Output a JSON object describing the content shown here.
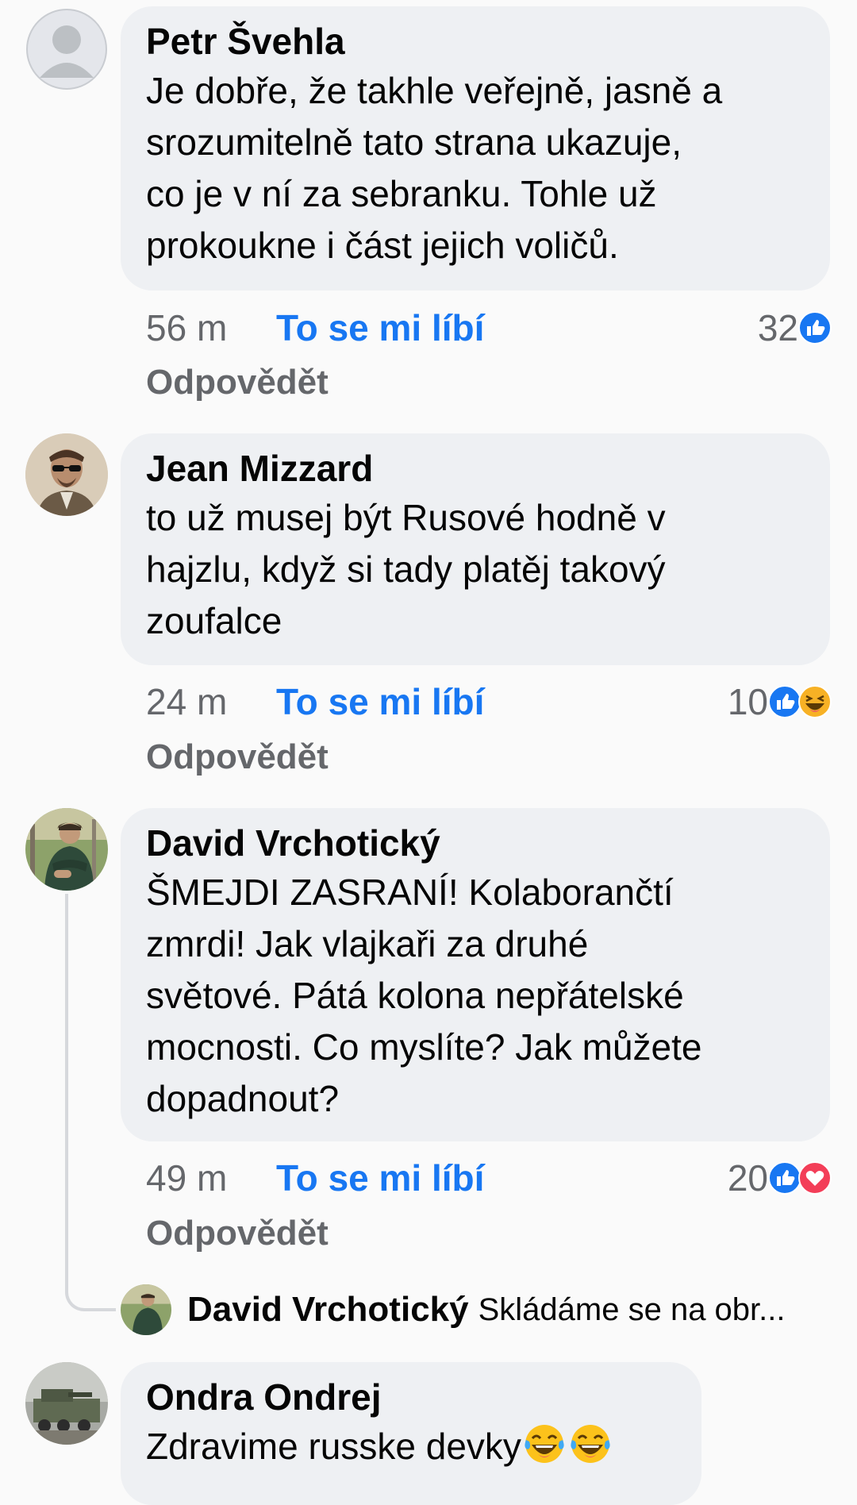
{
  "comments": [
    {
      "author": "Petr Švehla",
      "lines": [
        "Je dobře, že takhle veřejně, jasně a",
        "srozumitelně tato strana ukazuje,",
        "co je v ní za sebranku. Tohle už",
        "prokoukne i část jejich voličů."
      ],
      "time": "56 m",
      "like_label": "To se mi líbí",
      "reply_label": "Odpovědět",
      "reaction_count": "32",
      "reactions": [
        "like"
      ]
    },
    {
      "author": "Jean Mizzard",
      "lines": [
        "to už musej být Rusové hodně v",
        "hajzlu, když si tady platěj takový",
        "zoufalce"
      ],
      "time": "24 m",
      "like_label": "To se mi líbí",
      "reply_label": "Odpovědět",
      "reaction_count": "10",
      "reactions": [
        "like",
        "haha"
      ]
    },
    {
      "author": "David Vrchotický",
      "lines": [
        "ŠMEJDI ZASRANÍ! Kolaborančtí",
        "zmrdi! Jak vlajkaři za druhé",
        "světové. Pátá kolona nepřátelské",
        "mocnosti. Co myslíte? Jak můžete",
        "dopadnout?"
      ],
      "time": "49 m",
      "like_label": "To se mi líbí",
      "reply_label": "Odpovědět",
      "reaction_count": "20",
      "reactions": [
        "like",
        "love"
      ]
    },
    {
      "author": "Ondra Ondrej",
      "lines": [
        "Zdravime russke devky"
      ],
      "emojis": [
        "tears-of-joy",
        "tears-of-joy"
      ]
    }
  ],
  "reply_preview": {
    "author": "David Vrchotický",
    "snippet": "Skládáme se na obr..."
  },
  "colors": {
    "background": "#fafafa",
    "bubble": "#eef0f3",
    "link_blue": "#1877f2",
    "meta_gray": "#65676b",
    "love_red": "#f33e58",
    "haha_yellow": "#f7b125"
  }
}
